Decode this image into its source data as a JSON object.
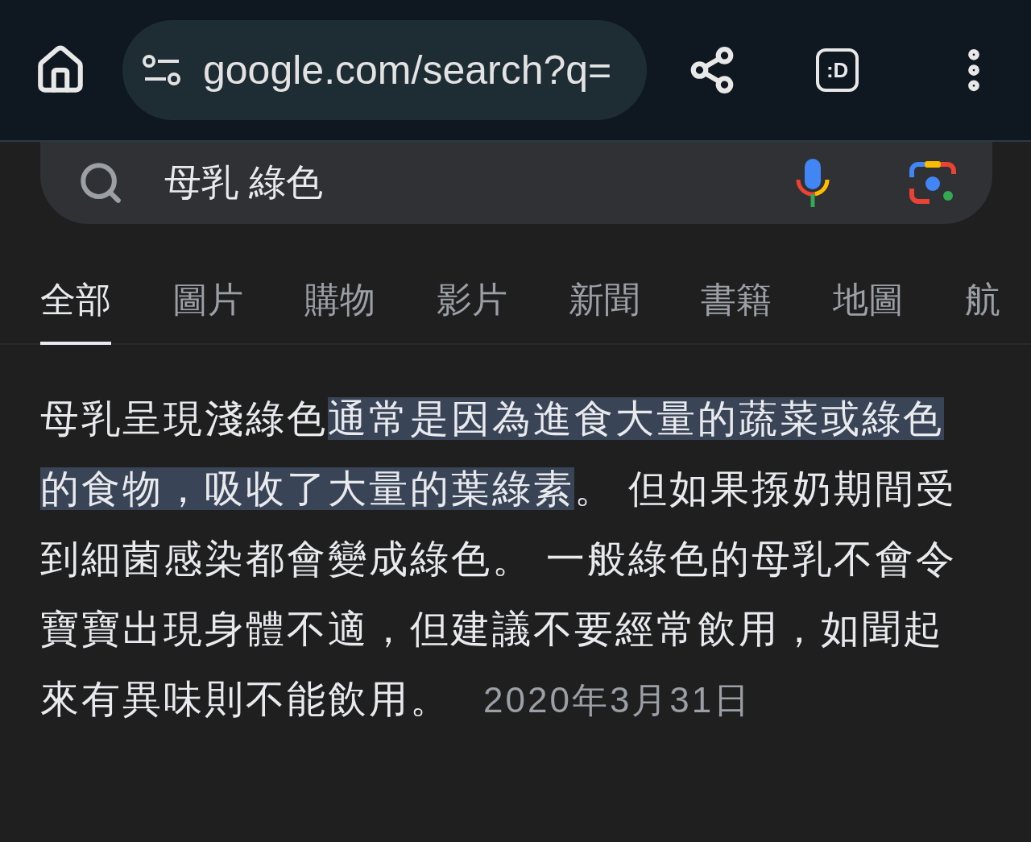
{
  "toolbar": {
    "url": "google.com/search?q=",
    "tab_switcher": ":D"
  },
  "search": {
    "query": "母乳 綠色"
  },
  "tabs": [
    {
      "label": "全部",
      "selected": true
    },
    {
      "label": "圖片",
      "selected": false
    },
    {
      "label": "購物",
      "selected": false
    },
    {
      "label": "影片",
      "selected": false
    },
    {
      "label": "新聞",
      "selected": false
    },
    {
      "label": "書籍",
      "selected": false
    },
    {
      "label": "地圖",
      "selected": false
    },
    {
      "label": "航",
      "selected": false
    }
  ],
  "snippet": {
    "segments": [
      {
        "text": "母乳呈現淺綠色",
        "highlighted": false
      },
      {
        "text": "通常是因為進食大量的蔬菜或綠色的食物，吸收了大量的葉綠素",
        "highlighted": true
      },
      {
        "text": "。 但如果揼奶期間受到細菌感染都會變成綠色。 一般綠色的母乳不會令寶寶出現身體不適，但建議不要經常飲用，如聞起來有異味則不能飲用。",
        "highlighted": false
      }
    ],
    "date": "2020年3月31日"
  }
}
